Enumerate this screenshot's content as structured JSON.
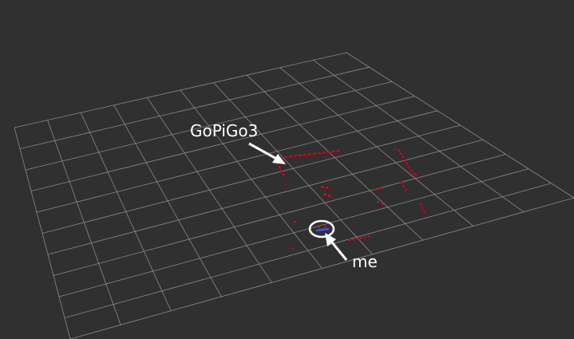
{
  "viewport": {
    "background": "#303030",
    "grid_color": "#9a9a9a",
    "scan_color": "#d8001e",
    "self_scan_color": "#3a56ff",
    "annotation_color": "#ffffff",
    "grid_cells": 10
  },
  "annotations": {
    "robot_label": "GoPiGo3",
    "self_label": "me"
  }
}
